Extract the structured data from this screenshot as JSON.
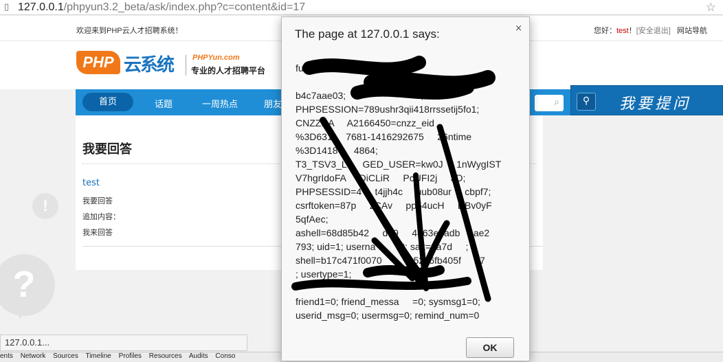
{
  "browser": {
    "url_host": "127.0.0.1",
    "url_rest": "/phpyun3.2_beta/ask/index.php?c=content&id=17",
    "star_icon": "star-icon"
  },
  "site": {
    "welcome": "欢迎来到PHP云人才招聘系统！",
    "greeting": "您好：",
    "username": "test",
    "greeting_end": "！",
    "logout": "[安全退出]",
    "site_nav": "网站导航",
    "logo_php": "PHP",
    "logo_cn": "云系统",
    "logo_site": "PHPYun.com",
    "logo_slogan": "专业的人才招聘平台",
    "nav": [
      "首页",
      "话题",
      "一周热点",
      "朋友"
    ],
    "ask_button": "我要提问"
  },
  "content": {
    "title": "我要回答",
    "user": "test",
    "line1": "我要回答",
    "line2": "追加内容：",
    "line3": "我来回答"
  },
  "status_bar": "127.0.0.1...",
  "devtools_tabs": [
    "ents",
    "Network",
    "Sources",
    "Timeline",
    "Profiles",
    "Resources",
    "Audits",
    "Conso"
  ],
  "dialog": {
    "title": "The page at 127.0.0.1 says:",
    "message": "fu                         in;\n                                    ea\nb4c7aae03;                          e;\nPHPSESSION=789ushr3qii418rrssetij5fo1;\nCNZZDA     A2166450=cnzz_eid\n%3D631     7681-1416292675     26ntime\n%3D1418      4864;\nT3_TSV3_L      GED_USER=kw0J     1nWygIST\nV7hgrIdoFA     DiCLiR     PcUFI2j     3D;\nPHPSESSID=4     t4jjh4c     uub08ur     cbpf7;\ncsrftoken=87p     zCAv     pp54ucH     DBv0yF\n5qfAec;\nashell=68d85b42     d59     4d63e5adb     ae2\n793; uid=1; userna          t; salt=1a7d     ;\nshell=b17c471f0070          c52c6fb405f     47\n; usertype=1;\n\nfriend1=0; friend_messa     =0; sysmsg1=0;\nuserid_msg=0; usermsg=0; remind_num=0",
    "ok_label": "OK",
    "close_glyph": "×"
  }
}
